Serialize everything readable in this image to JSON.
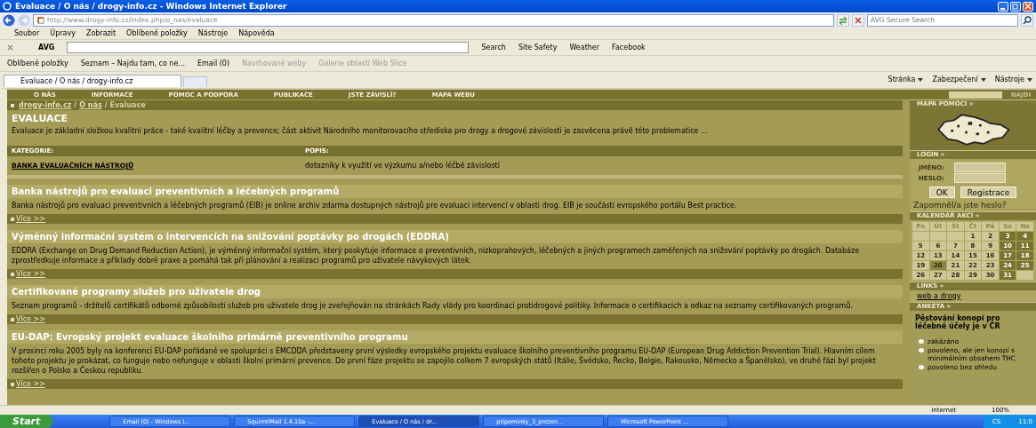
{
  "window": {
    "title": "Evaluace / O nás / drogy-info.cz - Windows Internet Explorer"
  },
  "address_bar": {
    "value": "http://www.drogy-info.cz/index.php/o_nas/evaluace",
    "search_placeholder": "AVG Secure Search"
  },
  "menu": [
    "Soubor",
    "Úpravy",
    "Zobrazit",
    "Oblíbené položky",
    "Nástroje",
    "Nápověda"
  ],
  "avg_toolbar": {
    "logo": "AVG",
    "items": [
      "Search",
      "Site Safety",
      "Weather",
      "Facebook"
    ]
  },
  "favorites_bar": {
    "label": "Oblíbené položky",
    "items": [
      "Seznam – Najdu tam, co ne...",
      "Email (0)",
      "Navrhované weby",
      "Galerie oblastí Web Slice"
    ]
  },
  "tab": {
    "label": "Evaluace / O nás / drogy-info.cz"
  },
  "command_bar": [
    "Stránka",
    "Zabezpečení",
    "Nástroje"
  ],
  "site_nav": {
    "items": [
      "O NÁS",
      "INFORMACE",
      "POMOC A PODPORA",
      "PUBLIKACE",
      "JSTE ZÁVISLÍ?",
      "MAPA WEBU"
    ],
    "search_button": "NAJDI"
  },
  "breadcrumb": {
    "separator": "/",
    "items": [
      {
        "label": "drogy-info.cz",
        "link": true
      },
      {
        "label": "O nás",
        "link": true
      },
      {
        "label": "Evaluace",
        "link": false
      }
    ]
  },
  "page": {
    "title": "EVALUACE",
    "intro": "Evaluace je základní složkou kvalitní práce - také kvalitní léčby a prevence; část aktivit Národního monitorovacího střediska pro drogy a drogové závislosti je zasvěcena právě této problematice ..."
  },
  "table": {
    "columns": [
      "KATEGORIE:",
      "POPIS:"
    ],
    "rows": [
      [
        "BANKA EVALUAČNÍCH NÁSTROJŮ",
        "dotazníky k využití ve výzkumu a/nebo léčbě závislostí"
      ]
    ]
  },
  "articles": [
    {
      "title": "Banka nástrojů pro evaluaci preventivních a léčebných programů",
      "text": "Banka nástrojů pro evaluaci preventivních a léčebných programů (EIB) je online archiv zdarma dostupných nástrojů pro evaluaci intervencí v oblasti drog. EIB je součástí evropského portálu Best practice.",
      "more": "Více >>"
    },
    {
      "title": "Výměnný informační systém o intervencích na snižování poptávky po drogách (EDDRA)",
      "text": "EDDRA (Exchange on Drug Demand Reduction Action), je výměnný informační systém, který poskytuje informace o preventivních, nízkoprahových, léčebných a jiných programech zaměřených na snižování poptávky po drogách. Databáze zprostředkuje informace a příklady dobré praxe a pomáhá tak při plánování a realizaci programů pro uživatele návykových látek.",
      "more": "Více >>"
    },
    {
      "title": "Certifikované programy služeb pro uživatele drog",
      "text": "Seznam programů - držitelů certifikátů odborné způsobilosti služeb pro uživatele drog je zveřejňován na stránkách Rady vlády pro koordinaci protidrogové politiky. Informace o certifikacích a odkaz na seznamy certifikovaných programů.",
      "more": "Více >>"
    },
    {
      "title": "EU-DAP: Evropský projekt evaluace školního primárně preventivního programu",
      "text": "V prosinci roku 2005 byly na konferenci EU-DAP pořádané ve spolupráci s EMCDDA představeny první výsledky evropského projektu evaluace školního preventivního programu EU-DAP (European Drug Addiction Prevention Trial). Hlavním cílem tohoto projektu je prokázat, co funguje nebo nefunguje v oblasti školní primární prevence. Do první fáze projektu se zapojilo celkem 7 evropských států (Itálie, Švédsko, Řecko, Belgie, Rakousko, Německo a Španělsko), ve druhé fázi byl projekt rozšířen o Polsko a Českou republiku.",
      "more": "Více >>"
    }
  ],
  "sidebar": {
    "map": {
      "heading": "MAPA POMOCI »"
    },
    "login": {
      "heading": "LOGIN »",
      "name_label": "JMÉNO:",
      "password_label": "HESLO:",
      "buttons": [
        "OK",
        "Registrace"
      ],
      "forgot_link": "Zapomněl/a jste heslo?"
    },
    "calendar": {
      "heading": "KALENDÁŘ AKCÍ »",
      "weekdays": [
        "Po",
        "Út",
        "St",
        "Čt",
        "Pá",
        "So",
        "Ne"
      ],
      "weeks": [
        [
          {
            "kind": "empty"
          },
          {
            "kind": "empty"
          },
          {
            "kind": "empty"
          },
          {
            "day": "1",
            "kind": "day"
          },
          {
            "day": "2",
            "kind": "day"
          },
          {
            "day": "3",
            "kind": "weekend"
          },
          {
            "day": "4",
            "kind": "weekend"
          }
        ],
        [
          {
            "day": "5",
            "kind": "day"
          },
          {
            "day": "6",
            "kind": "day"
          },
          {
            "day": "7",
            "kind": "day"
          },
          {
            "day": "8",
            "kind": "day"
          },
          {
            "day": "9",
            "kind": "day"
          },
          {
            "day": "10",
            "kind": "weekend"
          },
          {
            "day": "11",
            "kind": "weekend"
          }
        ],
        [
          {
            "day": "12",
            "kind": "day"
          },
          {
            "day": "13",
            "kind": "day"
          },
          {
            "day": "14",
            "kind": "day"
          },
          {
            "day": "15",
            "kind": "day"
          },
          {
            "day": "16",
            "kind": "day"
          },
          {
            "day": "17",
            "kind": "weekend"
          },
          {
            "day": "18",
            "kind": "weekend"
          }
        ],
        [
          {
            "day": "19",
            "kind": "day"
          },
          {
            "day": "20",
            "kind": "today"
          },
          {
            "day": "21",
            "kind": "day"
          },
          {
            "day": "22",
            "kind": "day"
          },
          {
            "day": "23",
            "kind": "day"
          },
          {
            "day": "24",
            "kind": "weekend"
          },
          {
            "day": "25",
            "kind": "weekend"
          }
        ],
        [
          {
            "day": "26",
            "kind": "day"
          },
          {
            "day": "27",
            "kind": "day"
          },
          {
            "day": "28",
            "kind": "day"
          },
          {
            "day": "29",
            "kind": "day"
          },
          {
            "day": "30",
            "kind": "day"
          },
          {
            "day": "31",
            "kind": "weekend"
          },
          {
            "kind": "empty"
          }
        ]
      ]
    },
    "links": {
      "heading": "LINKS »",
      "items": [
        "web a drogy"
      ]
    },
    "poll": {
      "heading": "ANKETA »",
      "question": "Pěstování konopí pro léčebné účely je v ČR",
      "options": [
        {
          "label": "zakázáno",
          "selected": false
        },
        {
          "label": "povoleno, ale jen konopí s minimálním obsahem THC",
          "selected": false
        },
        {
          "label": "povoleno bez ohledu",
          "selected": false
        }
      ]
    }
  },
  "status_bar": {
    "zone": "Internet",
    "zoom": "100%"
  },
  "taskbar": {
    "start": "Start",
    "items": [
      {
        "label": "Email (0) - Windows I...",
        "selected": false
      },
      {
        "label": "SquirrelMail 1.4.10a -...",
        "selected": false
      },
      {
        "label": "Evaluace / O nás / dr...",
        "selected": true
      },
      {
        "label": "pripominky_3_prezen...",
        "selected": false
      },
      {
        "label": "Microsoft PowerPoint ...",
        "selected": false
      }
    ],
    "language": "CS",
    "clock": "11:0"
  }
}
